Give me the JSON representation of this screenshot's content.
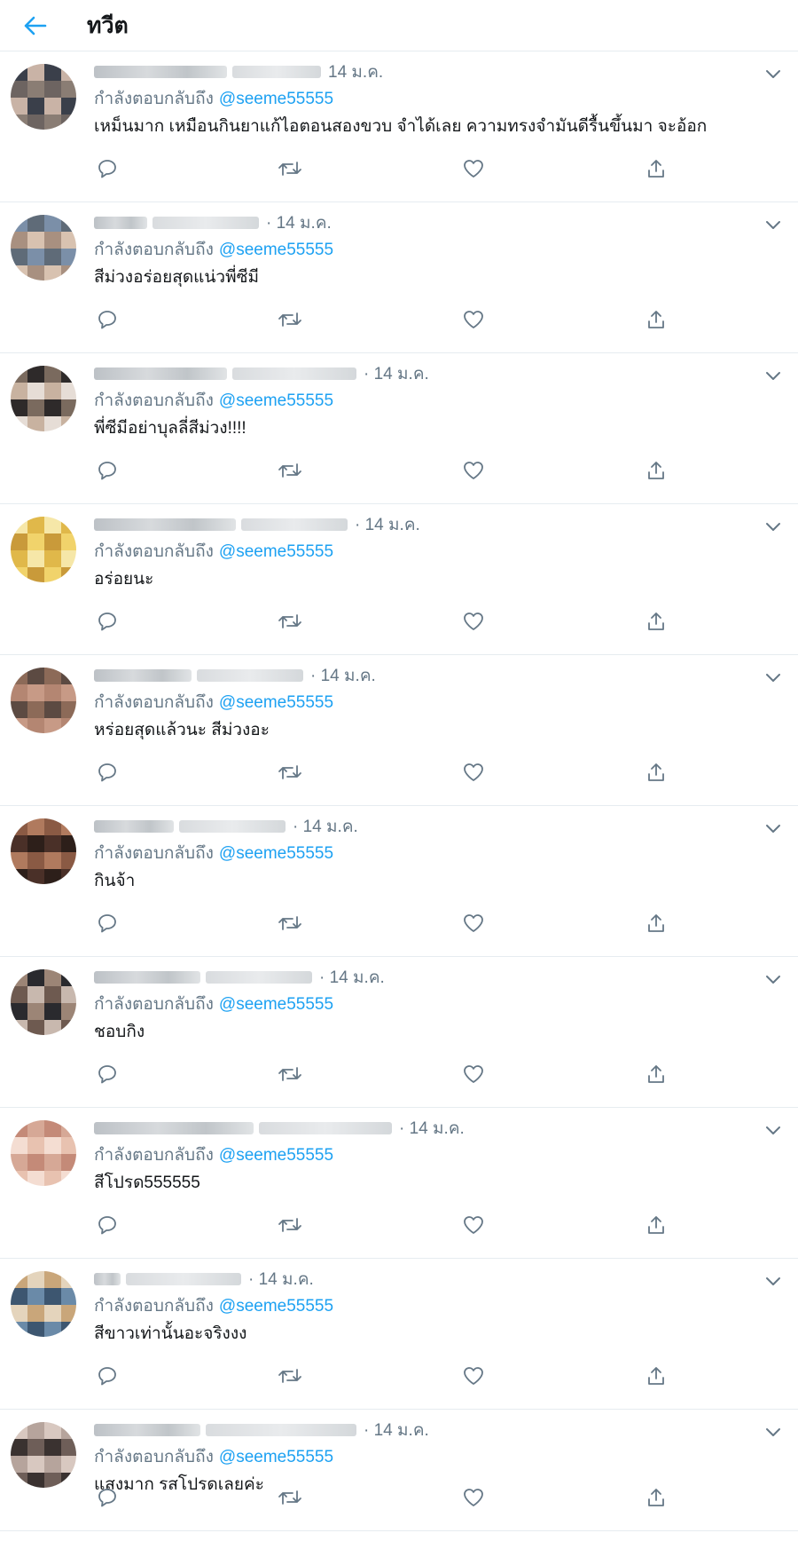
{
  "header": {
    "title": "ทวีต",
    "back_icon": "arrow-left-icon"
  },
  "reply_prefix": "กำลังตอบกลับถึง",
  "colors": {
    "accent": "#1da1f2",
    "muted": "#657786",
    "text": "#14171a",
    "border": "#e6ecf0"
  },
  "tweets": [
    {
      "date": "14 ม.ค.",
      "replying_to": "@seeme55555",
      "text": "เหม็นมาก เหมือนกินยาแก้ไอตอนสองขวบ จำได้เลย ความทรงจำมันดีรื้นขึ้นมา จะอ้อก"
    },
    {
      "date": "· 14 ม.ค.",
      "replying_to": "@seeme55555",
      "text": "สีม่วงอร่อยสุดแน่วพี่ซีมี"
    },
    {
      "date": "· 14 ม.ค.",
      "replying_to": "@seeme55555",
      "text": "พี่ซีมีอย่าบุลลี่สีม่วง!!!!"
    },
    {
      "date": "· 14 ม.ค.",
      "replying_to": "@seeme55555",
      "text": "อร่อยนะ"
    },
    {
      "date": "· 14 ม.ค.",
      "replying_to": "@seeme55555",
      "text": "หร่อยสุดแล้วนะ สีม่วงอะ"
    },
    {
      "date": "· 14 ม.ค.",
      "replying_to": "@seeme55555",
      "text": "กินจ้า"
    },
    {
      "date": "· 14 ม.ค.",
      "replying_to": "@seeme55555",
      "text": "ชอบกิง"
    },
    {
      "date": "· 14 ม.ค.",
      "replying_to": "@seeme55555",
      "text": "สีโปรด555555"
    },
    {
      "date": "· 14 ม.ค.",
      "replying_to": "@seeme55555",
      "text": "สีขาวเท่านั้นอะจริงงง"
    },
    {
      "date": "· 14 ม.ค.",
      "replying_to": "@seeme55555",
      "text": "แสงมาก รสโปรดเลยค่ะ"
    }
  ],
  "action_icons": [
    "reply-icon",
    "retweet-icon",
    "like-icon",
    "share-icon"
  ],
  "menu_icon": "chevron-down-icon"
}
